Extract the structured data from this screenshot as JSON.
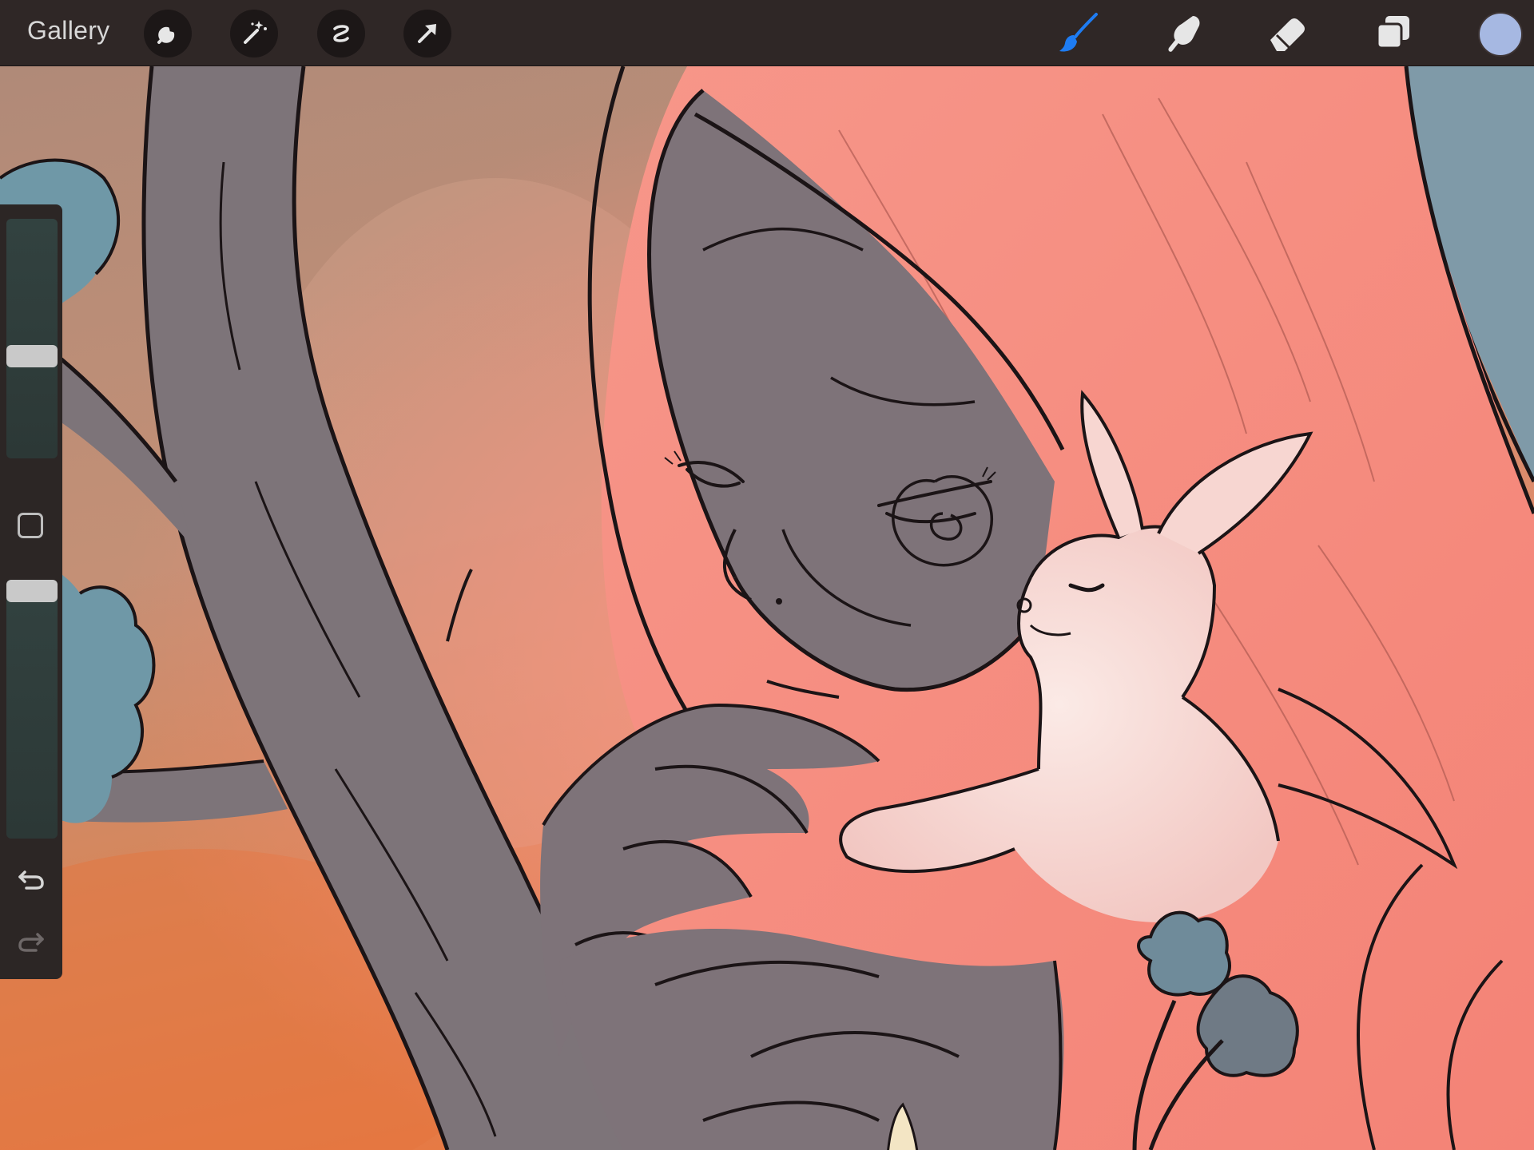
{
  "toolbar": {
    "gallery_label": "Gallery",
    "left_tools": [
      {
        "name": "actions",
        "icon": "wrench-icon"
      },
      {
        "name": "adjustments",
        "icon": "magic-wand-icon"
      },
      {
        "name": "selection",
        "icon": "selection-s-icon"
      },
      {
        "name": "transform",
        "icon": "arrow-cursor-icon"
      }
    ],
    "right_tools": [
      {
        "name": "brush",
        "icon": "brush-icon",
        "active": true
      },
      {
        "name": "smudge",
        "icon": "smudge-finger-icon",
        "active": false
      },
      {
        "name": "eraser",
        "icon": "eraser-icon",
        "active": false
      },
      {
        "name": "layers",
        "icon": "layers-icon",
        "active": false
      }
    ],
    "current_color": "#a6b8e2",
    "active_tool_color": "#1e7cf2",
    "inactive_tool_color": "#e6e6e6"
  },
  "sidebar": {
    "brush_size": 0.42,
    "brush_opacity": 1.0,
    "modify_button_icon": "square-modify-icon",
    "undo_icon": "undo-arrow-icon",
    "redo_icon": "redo-arrow-icon"
  },
  "canvas": {
    "palette": {
      "background_warm": "#b98366",
      "background_orange": "#e07a4a",
      "hair_pink": "#f48a7e",
      "skin_grey": "#7e7379",
      "tree_grey": "#7d7479",
      "foliage_blue": "#6f98a7",
      "bunny_white": "#f7dfdc",
      "line_dark": "#1b1416"
    }
  }
}
